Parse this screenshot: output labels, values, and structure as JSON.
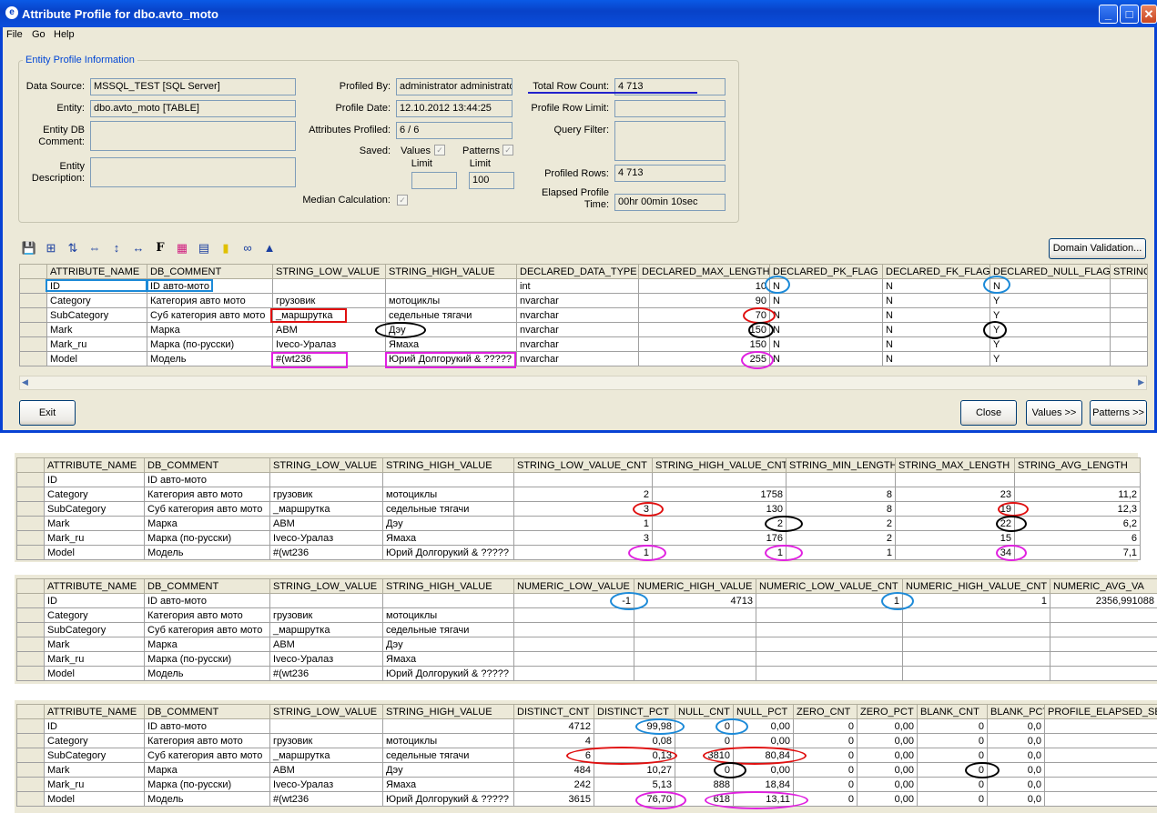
{
  "window": {
    "title": "Attribute Profile for dbo.avto_moto",
    "app_icon": "database-icon"
  },
  "menu": [
    "File",
    "Go",
    "Help"
  ],
  "colors": {
    "blue": "#1c8ad8",
    "red": "#e01010",
    "black": "#000000",
    "magenta": "#e020e0",
    "underline": "#2222cc"
  },
  "info": {
    "legend": "Entity Profile Information",
    "data_source_label": "Data Source:",
    "data_source": "MSSQL_TEST [SQL Server]",
    "entity_label": "Entity:",
    "entity": "dbo.avto_moto [TABLE]",
    "entity_db_comment_label": "Entity DB Comment:",
    "entity_db_comment": "",
    "entity_description_label": "Entity Description:",
    "entity_description": "",
    "profiled_by_label": "Profiled By:",
    "profiled_by": "administrator administrator",
    "profile_date_label": "Profile Date:",
    "profile_date": "12.10.2012 13:44:25",
    "attributes_profiled_label": "Attributes Profiled:",
    "attributes_profiled": "6 / 6",
    "saved_label": "Saved:",
    "values_label": "Values",
    "patterns_label": "Patterns",
    "limit_label": "Limit",
    "values_limit": "",
    "patterns_limit": "100",
    "median_label": "Median Calculation:",
    "total_row_count_label": "Total Row Count:",
    "total_row_count": "4 713",
    "profile_row_limit_label": "Profile Row Limit:",
    "profile_row_limit": "",
    "query_filter_label": "Query Filter:",
    "query_filter": "",
    "profiled_rows_label": "Profiled Rows:",
    "profiled_rows": "4 713",
    "elapsed_label": "Elapsed Profile Time:",
    "elapsed": "00hr 00min 10sec"
  },
  "toolbar_icons": [
    "save-icon",
    "filter-icon",
    "sort-az-icon",
    "expand-columns-icon",
    "row-height-icon",
    "column-width-icon",
    "font-icon",
    "color-palette-icon",
    "grid-icon",
    "note-icon",
    "binoculars-icon",
    "triangle-up-icon"
  ],
  "buttons": {
    "domain_validation": "Domain Validation...",
    "exit": "Exit",
    "close": "Close",
    "values": "Values >>",
    "patterns": "Patterns >>"
  },
  "grid1": {
    "columns": [
      "ATTRIBUTE_NAME",
      "DB_COMMENT",
      "STRING_LOW_VALUE",
      "STRING_HIGH_VALUE",
      "DECLARED_DATA_TYPE",
      "DECLARED_MAX_LENGTH",
      "DECLARED_PK_FLAG",
      "DECLARED_FK_FLAG",
      "DECLARED_NULL_FLAG",
      "STRING"
    ],
    "rows": [
      [
        "ID",
        "ID авто-мото",
        "",
        "",
        "int",
        "10",
        "N",
        "N",
        "N",
        ""
      ],
      [
        "Category",
        "Категория авто мото",
        "грузовик",
        "мотоциклы",
        "nvarchar",
        "90",
        "N",
        "N",
        "Y",
        ""
      ],
      [
        "SubCategory",
        "Суб категория авто мото",
        "_маршрутка",
        "седельные тягачи",
        "nvarchar",
        "70",
        "N",
        "N",
        "Y",
        ""
      ],
      [
        "Mark",
        "Марка",
        "ABM",
        "Дэу",
        "nvarchar",
        "150",
        "N",
        "N",
        "Y",
        ""
      ],
      [
        "Mark_ru",
        "Марка (по-русски)",
        "Iveco-Уралаз",
        "Ямаха",
        "nvarchar",
        "150",
        "N",
        "N",
        "Y",
        ""
      ],
      [
        "Model",
        "Модель",
        "#(wt236",
        "Юрий Долгорукий & ?????",
        "nvarchar",
        "255",
        "N",
        "N",
        "Y",
        ""
      ]
    ]
  },
  "grid2": {
    "columns": [
      "ATTRIBUTE_NAME",
      "DB_COMMENT",
      "STRING_LOW_VALUE",
      "STRING_HIGH_VALUE",
      "STRING_LOW_VALUE_CNT",
      "STRING_HIGH_VALUE_CNT",
      "STRING_MIN_LENGTH",
      "STRING_MAX_LENGTH",
      "STRING_AVG_LENGTH"
    ],
    "rows": [
      [
        "ID",
        "ID авто-мото",
        "",
        "",
        "",
        "",
        "",
        "",
        ""
      ],
      [
        "Category",
        "Категория авто мото",
        "грузовик",
        "мотоциклы",
        "2",
        "1758",
        "8",
        "23",
        "11,2"
      ],
      [
        "SubCategory",
        "Суб категория авто мото",
        "_маршрутка",
        "седельные тягачи",
        "3",
        "130",
        "8",
        "19",
        "12,3"
      ],
      [
        "Mark",
        "Марка",
        "ABM",
        "Дэу",
        "1",
        "2",
        "2",
        "22",
        "6,2"
      ],
      [
        "Mark_ru",
        "Марка (по-русски)",
        "Iveco-Уралаз",
        "Ямаха",
        "3",
        "176",
        "2",
        "15",
        "6"
      ],
      [
        "Model",
        "Модель",
        "#(wt236",
        "Юрий Долгорукий & ?????",
        "1",
        "1",
        "1",
        "34",
        "7,1"
      ]
    ]
  },
  "grid3": {
    "columns": [
      "ATTRIBUTE_NAME",
      "DB_COMMENT",
      "STRING_LOW_VALUE",
      "STRING_HIGH_VALUE",
      "NUMERIC_LOW_VALUE",
      "NUMERIC_HIGH_VALUE",
      "NUMERIC_LOW_VALUE_CNT",
      "NUMERIC_HIGH_VALUE_CNT",
      "NUMERIC_AVG_VA"
    ],
    "rows": [
      [
        "ID",
        "ID авто-мото",
        "",
        "",
        "-1",
        "4713",
        "1",
        "1",
        "2356,991088"
      ],
      [
        "Category",
        "Категория авто мото",
        "грузовик",
        "мотоциклы",
        "",
        "",
        "",
        "",
        ""
      ],
      [
        "SubCategory",
        "Суб категория авто мото",
        "_маршрутка",
        "седельные тягачи",
        "",
        "",
        "",
        "",
        ""
      ],
      [
        "Mark",
        "Марка",
        "ABM",
        "Дэу",
        "",
        "",
        "",
        "",
        ""
      ],
      [
        "Mark_ru",
        "Марка (по-русски)",
        "Iveco-Уралаз",
        "Ямаха",
        "",
        "",
        "",
        "",
        ""
      ],
      [
        "Model",
        "Модель",
        "#(wt236",
        "Юрий Долгорукий & ?????",
        "",
        "",
        "",
        "",
        ""
      ]
    ]
  },
  "grid4": {
    "columns": [
      "ATTRIBUTE_NAME",
      "DB_COMMENT",
      "STRING_LOW_VALUE",
      "STRING_HIGH_VALUE",
      "DISTINCT_CNT",
      "DISTINCT_PCT",
      "NULL_CNT",
      "NULL_PCT",
      "ZERO_CNT",
      "ZERO_PCT",
      "BLANK_CNT",
      "BLANK_PCT",
      "PROFILE_ELAPSED_SE"
    ],
    "rows": [
      [
        "ID",
        "ID авто-мото",
        "",
        "",
        "4712",
        "99,98",
        "0",
        "0,00",
        "0",
        "0,00",
        "0",
        "0,0",
        ""
      ],
      [
        "Category",
        "Категория авто мото",
        "грузовик",
        "мотоциклы",
        "4",
        "0,08",
        "0",
        "0,00",
        "0",
        "0,00",
        "0",
        "0,0",
        ""
      ],
      [
        "SubCategory",
        "Суб категория авто мото",
        "_маршрутка",
        "седельные тягачи",
        "6",
        "0,13",
        "3810",
        "80,84",
        "0",
        "0,00",
        "0",
        "0,0",
        ""
      ],
      [
        "Mark",
        "Марка",
        "ABM",
        "Дэу",
        "484",
        "10,27",
        "0",
        "0,00",
        "0",
        "0,00",
        "0",
        "0,0",
        ""
      ],
      [
        "Mark_ru",
        "Марка (по-русски)",
        "Iveco-Уралаз",
        "Ямаха",
        "242",
        "5,13",
        "888",
        "18,84",
        "0",
        "0,00",
        "0",
        "0,0",
        ""
      ],
      [
        "Model",
        "Модель",
        "#(wt236",
        "Юрий Долгорукий & ?????",
        "3615",
        "76,70",
        "618",
        "13,11",
        "0",
        "0,00",
        "0",
        "0,0",
        ""
      ]
    ]
  }
}
